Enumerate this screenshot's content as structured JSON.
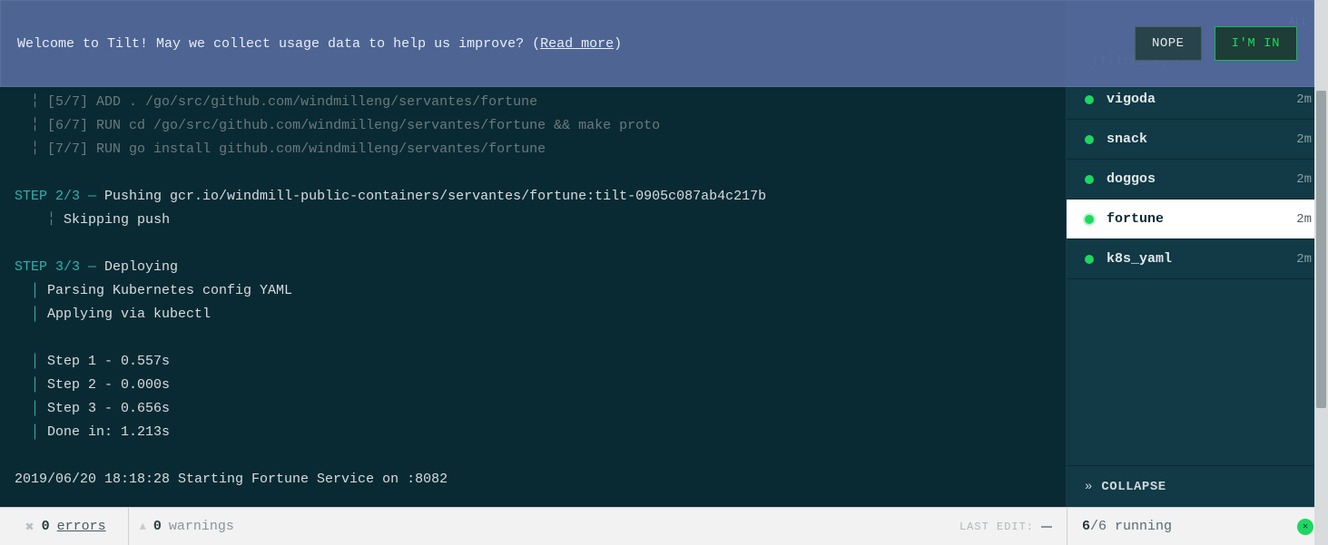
{
  "banner": {
    "text_pre": "Welcome to Tilt! May we collect usage data to help us improve? (",
    "link": "Read more",
    "text_post": ")",
    "nope": "NOPE",
    "imin": "I'M IN"
  },
  "sidebar": {
    "tab_all": "ALL",
    "header_label": "(Tiltfile)",
    "collapse": "COLLAPSE",
    "items": [
      {
        "name": "vigoda",
        "time": "2m",
        "selected": false
      },
      {
        "name": "snack",
        "time": "2m",
        "selected": false
      },
      {
        "name": "doggos",
        "time": "2m",
        "selected": false
      },
      {
        "name": "fortune",
        "time": "2m",
        "selected": true
      },
      {
        "name": "k8s_yaml",
        "time": "2m",
        "selected": false
      }
    ]
  },
  "logs": {
    "l1": "  ╎ [5/7] ADD . /go/src/github.com/windmilleng/servantes/fortune",
    "l2": "  ╎ [6/7] RUN cd /go/src/github.com/windmilleng/servantes/fortune && make proto",
    "l3": "  ╎ [7/7] RUN go install github.com/windmilleng/servantes/fortune",
    "s2_step": "STEP 2/3",
    "s2_dash": " — ",
    "s2_rest": "Pushing gcr.io/windmill-public-containers/servantes/fortune:tilt-0905c087ab4c217b",
    "skip_pipe": "    ╎ ",
    "skip": "Skipping push",
    "s3_step": "STEP 3/3",
    "s3_dash": " — ",
    "s3_rest": "Deploying",
    "dp1_pipe": "  │ ",
    "dp1": "Parsing Kubernetes config YAML",
    "dp2_pipe": "  │ ",
    "dp2": "Applying via kubectl",
    "t1_pipe": "  │ ",
    "t1": "Step 1 - 0.557s",
    "t2_pipe": "  │ ",
    "t2": "Step 2 - 0.000s",
    "t3_pipe": "  │ ",
    "t3": "Step 3 - 0.656s",
    "t4_pipe": "  │ ",
    "t4": "Done in: 1.213s",
    "final": "2019/06/20 18:18:28 Starting Fortune Service on :8082"
  },
  "status": {
    "err_count": "0",
    "err_label": "errors",
    "warn_count": "0",
    "warn_label": "warnings",
    "last_edit": "LAST EDIT:",
    "running_strong": "6",
    "running_rest": "/6 running",
    "conn_glyph": "✕"
  }
}
